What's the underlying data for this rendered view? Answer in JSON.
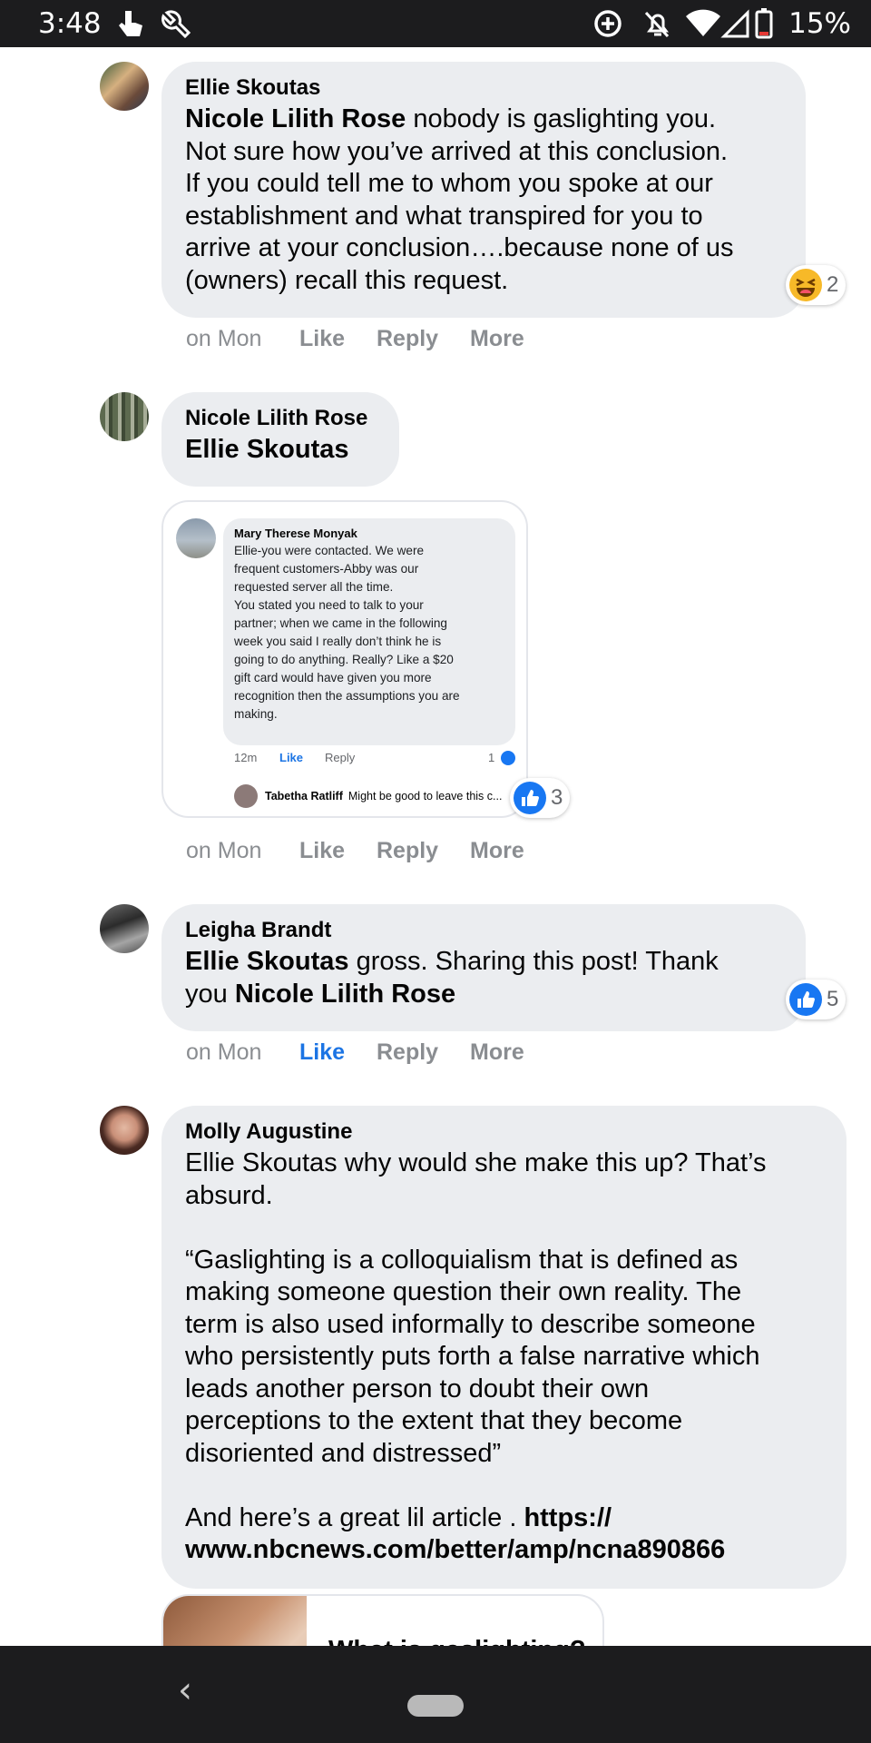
{
  "status_bar": {
    "time": "3:48",
    "battery": "15%",
    "icons": [
      "touch-icon",
      "wrench-icon",
      "data-saver-icon",
      "notifications-off-icon",
      "wifi-icon",
      "signal-icon",
      "battery-icon"
    ]
  },
  "colors": {
    "bubble": "#ebedf0",
    "like_blue": "#1877f2",
    "liked_text": "#1b74e4",
    "meta_gray": "#8a8d91"
  },
  "comments": [
    {
      "author": "Ellie Skoutas",
      "mention": "Nicole Lilith Rose",
      "body_lines": [
        " nobody is gaslighting you.",
        "Not sure how you’ve arrived at this conclusion.",
        "If you could tell me to whom you spoke at our",
        "establishment and what transpired for you to",
        "arrive at your conclusion….because none of us",
        "(owners) recall this request."
      ],
      "reaction": {
        "icon": "haha-icon",
        "count": "2"
      },
      "time": "on Mon",
      "like": "Like",
      "reply": "Reply",
      "more": "More"
    },
    {
      "author": "Nicole Lilith Rose",
      "mention": "Ellie Skoutas",
      "reaction": {
        "icon": "like-icon",
        "count": "3"
      },
      "time": "on Mon",
      "like": "Like",
      "reply": "Reply",
      "more": "More",
      "attachment": {
        "author": "Mary Therese Monyak",
        "lines": [
          "Ellie-you were contacted. We were",
          "frequent customers-Abby was our",
          "requested server all the time.",
          "You stated you need to talk to your",
          "partner; when we came in the following",
          "week you said I really don’t think he is",
          "going to do anything. Really? Like a $20",
          "gift card would have given you more",
          "recognition then the assumptions you are",
          "making."
        ],
        "time": "12m",
        "like": "Like",
        "reply": "Reply",
        "like_count": "1",
        "reply_author": "Tabetha Ratliff",
        "reply_text": "Might be good to leave this c..."
      }
    },
    {
      "author": "Leigha Brandt",
      "mention": "Ellie Skoutas",
      "body_line1_rest": " gross. Sharing this post! Thank",
      "body_line2_prefix": "you ",
      "mention2": "Nicole Lilith Rose",
      "reaction": {
        "icon": "like-icon",
        "count": "5"
      },
      "time": "on Mon",
      "like": "Like",
      "reply": "Reply",
      "more": "More"
    },
    {
      "author": "Molly Augustine",
      "para1": [
        "Ellie Skoutas why would she make this up? That’s",
        "absurd."
      ],
      "para2": [
        "“Gaslighting is a colloquialism that is defined as",
        "making someone question their own reality. The",
        "term is also used informally to describe someone",
        "who persistently puts forth a false narrative which",
        "leads another person to doubt their own",
        "perceptions to the extent that they become",
        "disoriented and distressed”"
      ],
      "para3_prefix": "And here’s a great lil article . ",
      "link_line1": "https://",
      "link_line2": "www.nbcnews.com/better/amp/ncna890866",
      "link_preview_title": "What is gaslighting?"
    }
  ],
  "nav": {
    "back": "‹"
  }
}
